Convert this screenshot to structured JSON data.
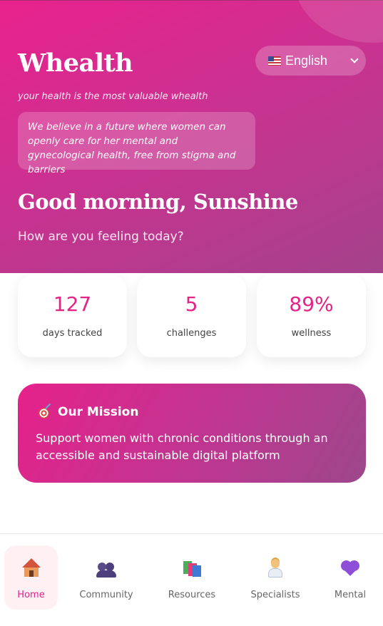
{
  "app": {
    "title": "Whealth",
    "tagline": "your health is the most valuable whealth",
    "belief": "We believe in a future where women can openly care for her mental and gynecological health, free from stigma and barriers"
  },
  "language": {
    "selected": "English",
    "flag_icon": "us-flag-icon"
  },
  "greeting": {
    "title": "Good morning, Sunshine",
    "subtitle": "How are you feeling today?"
  },
  "stats": [
    {
      "value": "127",
      "label": "days tracked"
    },
    {
      "value": "5",
      "label": "challenges"
    },
    {
      "value": "89%",
      "label": "wellness"
    }
  ],
  "mission": {
    "icon": "target-icon",
    "title": "Our Mission",
    "body": "Support women with chronic conditions through an accessible and sustainable digital platform"
  },
  "nav": [
    {
      "label": "Home",
      "icon": "house-icon",
      "active": true
    },
    {
      "label": "Community",
      "icon": "people-icon",
      "active": false
    },
    {
      "label": "Resources",
      "icon": "books-icon",
      "active": false
    },
    {
      "label": "Specialists",
      "icon": "health-worker-icon",
      "active": false
    },
    {
      "label": "Mental",
      "icon": "heart-icon",
      "active": false
    }
  ],
  "colors": {
    "brand_pink": "#e32386",
    "gradient_start": "#e9218d",
    "gradient_end": "#a4428c",
    "active_tab_bg": "#fff0f4"
  }
}
